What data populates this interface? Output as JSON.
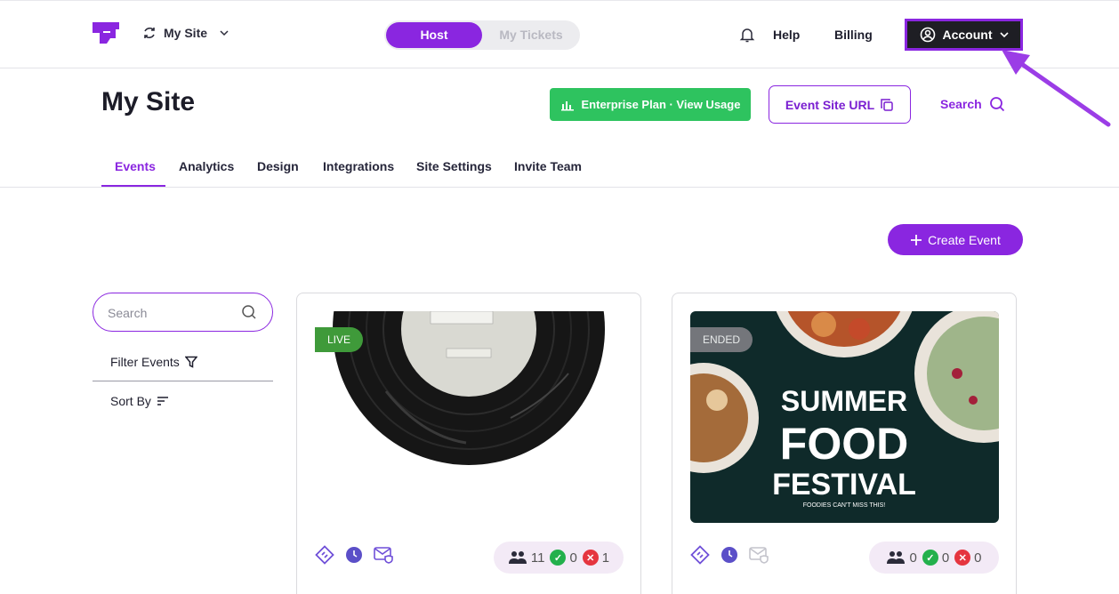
{
  "topbar": {
    "site_name": "My Site",
    "toggle": {
      "host": "Host",
      "tickets": "My Tickets"
    },
    "help": "Help",
    "billing": "Billing",
    "account": "Account"
  },
  "header": {
    "title": "My Site",
    "plan_button": "Enterprise Plan · View Usage",
    "site_url_button": "Event Site URL",
    "search_link": "Search"
  },
  "tabs": [
    {
      "label": "Events",
      "active": true
    },
    {
      "label": "Analytics",
      "active": false
    },
    {
      "label": "Design",
      "active": false
    },
    {
      "label": "Integrations",
      "active": false
    },
    {
      "label": "Site Settings",
      "active": false
    },
    {
      "label": "Invite Team",
      "active": false
    }
  ],
  "create_event": "Create Event",
  "filters": {
    "search_placeholder": "Search",
    "filter_label": "Filter Events",
    "sort_label": "Sort By"
  },
  "events": [
    {
      "status": "LIVE",
      "attendees": "11",
      "approved": "0",
      "declined": "1"
    },
    {
      "status": "ENDED",
      "poster_line1": "SUMMER",
      "poster_line2": "FOOD",
      "poster_line3": "FESTIVAL",
      "poster_tagline": "FOODIES CAN'T MISS THIS!",
      "attendees": "0",
      "approved": "0",
      "declined": "0"
    }
  ],
  "colors": {
    "brand_purple": "#8a26e0",
    "plan_green": "#2ec35f",
    "live_green": "#3f9a3a",
    "ended_gray": "#7f7f84",
    "account_bg": "#1e1e24"
  }
}
